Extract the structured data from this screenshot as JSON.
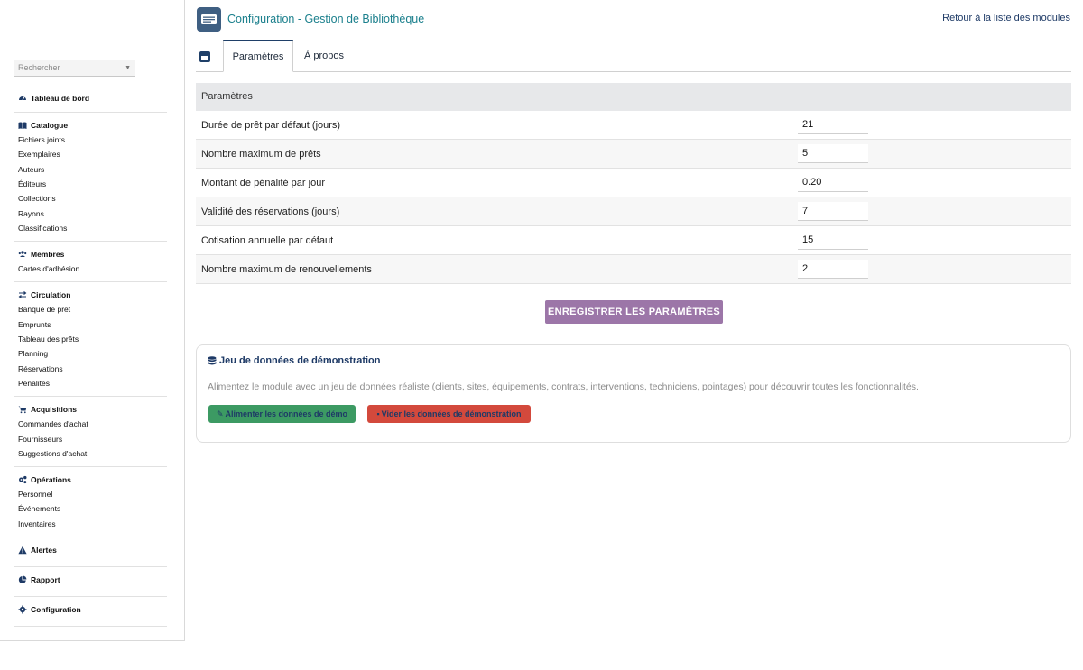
{
  "header": {
    "title": "Configuration - Gestion de Bibliothèque",
    "back_link": "Retour à la liste des modules"
  },
  "sidebar": {
    "search_placeholder": "Rechercher",
    "dashboard": "Tableau de bord",
    "sections": [
      {
        "label": "Catalogue",
        "icon": "book-icon",
        "items": [
          "Fichiers joints",
          "Exemplaires",
          "Auteurs",
          "Éditeurs",
          "Collections",
          "Rayons",
          "Classifications"
        ]
      },
      {
        "label": "Membres",
        "icon": "users-icon",
        "items": [
          "Cartes d'adhésion"
        ]
      },
      {
        "label": "Circulation",
        "icon": "exchange-icon",
        "items": [
          "Banque de prêt",
          "Emprunts",
          "Tableau des prêts",
          "Planning",
          "Réservations",
          "Pénalités"
        ]
      },
      {
        "label": "Acquisitions",
        "icon": "cart-icon",
        "items": [
          "Commandes d'achat",
          "Fournisseurs",
          "Suggestions d'achat"
        ]
      },
      {
        "label": "Opérations",
        "icon": "cogs-icon",
        "items": [
          "Personnel",
          "Événements",
          "Inventaires"
        ]
      },
      {
        "label": "Alertes",
        "icon": "warning-icon",
        "items": []
      },
      {
        "label": "Rapport",
        "icon": "pie-chart-icon",
        "items": []
      },
      {
        "label": "Configuration",
        "icon": "gear-icon",
        "items": []
      }
    ]
  },
  "tabs": [
    {
      "label": "Paramètres",
      "active": true
    },
    {
      "label": "À propos",
      "active": false
    }
  ],
  "params": {
    "heading": "Paramètres",
    "rows": [
      {
        "label": "Durée de prêt par défaut (jours)",
        "value": "21"
      },
      {
        "label": "Nombre maximum de prêts",
        "value": "5"
      },
      {
        "label": "Montant de pénalité par jour",
        "value": "0.20"
      },
      {
        "label": "Validité des réservations (jours)",
        "value": "7"
      },
      {
        "label": "Cotisation annuelle par défaut",
        "value": "15"
      },
      {
        "label": "Nombre maximum de renouvellements",
        "value": "2"
      }
    ],
    "save_label": "ENREGISTRER LES PARAMÈTRES"
  },
  "demo": {
    "title": "Jeu de données de démonstration",
    "description": "Alimentez le module avec un jeu de données réaliste (clients, sites, équipements, contrats, interventions, techniciens, pointages) pour découvrir toutes les fonctionnalités.",
    "fill_label": "Alimenter les données de démo",
    "clear_label": "Vider les données de démonstration"
  },
  "colors": {
    "accent": "#1f3f68",
    "title": "#1a7f8c",
    "save_button": "#9c76a8",
    "fill_button": "#3c9a63",
    "clear_button": "#d3493c"
  }
}
